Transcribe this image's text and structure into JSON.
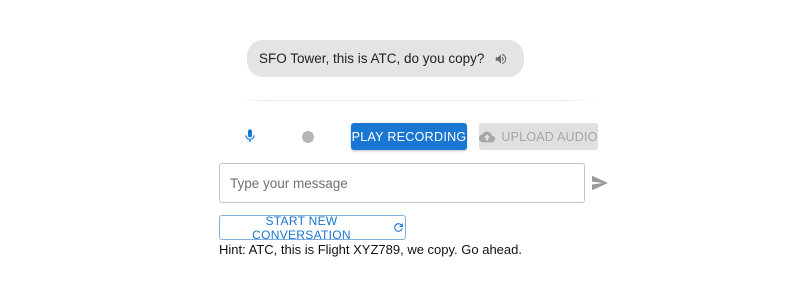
{
  "chat": {
    "messages": [
      {
        "text": "SFO Tower, this is ATC, do you copy?",
        "speaker_icon": "volume-icon"
      }
    ]
  },
  "controls": {
    "mic_icon": "microphone-icon",
    "play_recording_label": "PLAY RECORDING",
    "upload_audio_label": "UPLOAD AUDIO",
    "upload_icon": "cloud-upload-icon",
    "upload_disabled": true
  },
  "composer": {
    "placeholder": "Type your message",
    "value": "",
    "send_icon": "send-icon"
  },
  "new_conversation": {
    "label": "START NEW CONVERSATION",
    "icon": "refresh-icon"
  },
  "hint": "Hint: ATC, this is Flight XYZ789, we copy. Go ahead.",
  "colors": {
    "primary": "#1976d2",
    "bubble_bg": "#e4e4e4",
    "disabled_bg": "#e0e0e0",
    "disabled_text": "#a6a6a6",
    "recording_dot": "#b5b5b5"
  }
}
